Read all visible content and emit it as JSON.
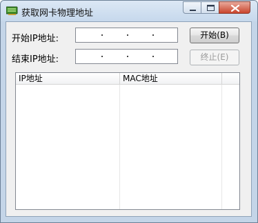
{
  "window": {
    "title": "获取网卡物理地址",
    "controls": [
      "minimize-icon",
      "maximize-icon",
      "close-icon"
    ]
  },
  "form": {
    "start_ip_label": "开始IP地址:",
    "end_ip_label": "结束IP地址:",
    "start_ip_value": "",
    "end_ip_value": ""
  },
  "buttons": {
    "start_label": "开始(B)",
    "stop_label": "终止(E)"
  },
  "list": {
    "columns": [
      "IP地址",
      "MAC地址"
    ],
    "rows": []
  }
}
